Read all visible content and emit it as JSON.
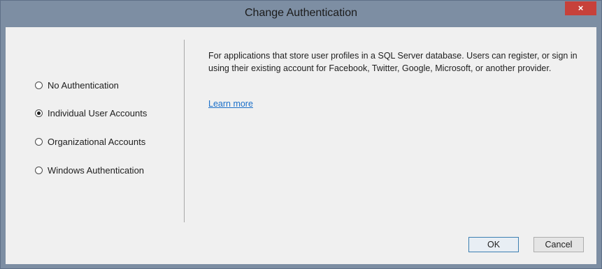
{
  "window": {
    "title": "Change Authentication",
    "close_glyph": "×"
  },
  "options": [
    {
      "label": "No Authentication",
      "selected": false
    },
    {
      "label": "Individual User Accounts",
      "selected": true
    },
    {
      "label": "Organizational Accounts",
      "selected": false
    },
    {
      "label": "Windows Authentication",
      "selected": false
    }
  ],
  "description": {
    "text": "For applications that store user profiles in a SQL Server database. Users can register, or sign in using their existing account for Facebook, Twitter, Google, Microsoft, or another provider.",
    "learn_more": "Learn more"
  },
  "buttons": {
    "ok": "OK",
    "cancel": "Cancel"
  },
  "colors": {
    "titlebar": "#7d8ea3",
    "close": "#c7413a",
    "link": "#1a6fc9"
  }
}
